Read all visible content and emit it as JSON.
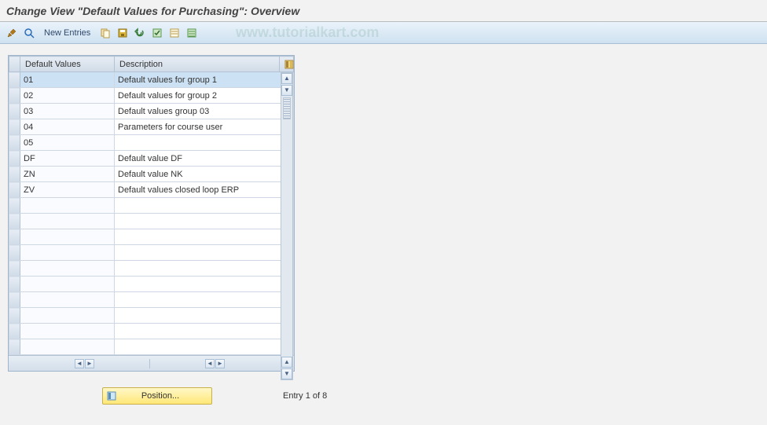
{
  "title": "Change View \"Default Values for Purchasing\": Overview",
  "toolbar": {
    "new_entries_label": "New Entries"
  },
  "watermark": "www.tutorialkart.com",
  "table": {
    "headers": {
      "col1": "Default Values",
      "col2": "Description"
    },
    "rows": [
      {
        "dv": "01",
        "desc": "Default values for group 1",
        "selected": true
      },
      {
        "dv": "02",
        "desc": "Default values for group 2",
        "selected": false
      },
      {
        "dv": "03",
        "desc": "Default values group 03",
        "selected": false
      },
      {
        "dv": "04",
        "desc": "Parameters for course user",
        "selected": false
      },
      {
        "dv": "05",
        "desc": "",
        "selected": false
      },
      {
        "dv": "DF",
        "desc": "Default value DF",
        "selected": false
      },
      {
        "dv": "ZN",
        "desc": "Default value NK",
        "selected": false
      },
      {
        "dv": "ZV",
        "desc": "Default values closed loop ERP",
        "selected": false
      },
      {
        "dv": "",
        "desc": "",
        "selected": false
      },
      {
        "dv": "",
        "desc": "",
        "selected": false
      },
      {
        "dv": "",
        "desc": "",
        "selected": false
      },
      {
        "dv": "",
        "desc": "",
        "selected": false
      },
      {
        "dv": "",
        "desc": "",
        "selected": false
      },
      {
        "dv": "",
        "desc": "",
        "selected": false
      },
      {
        "dv": "",
        "desc": "",
        "selected": false
      },
      {
        "dv": "",
        "desc": "",
        "selected": false
      },
      {
        "dv": "",
        "desc": "",
        "selected": false
      },
      {
        "dv": "",
        "desc": "",
        "selected": false
      }
    ]
  },
  "footer": {
    "position_label": "Position...",
    "entry_info": "Entry 1 of 8"
  }
}
